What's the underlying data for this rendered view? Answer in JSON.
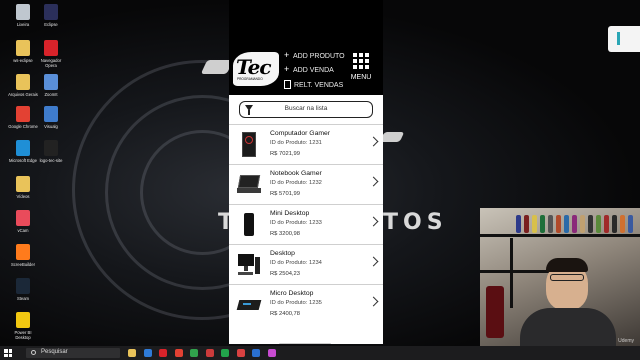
{
  "desktop": {
    "icons": [
      {
        "label": "Lixeira",
        "color": "#bfc7cf"
      },
      {
        "label": "Eclipse",
        "color": "#2b2f5a"
      },
      {
        "label": "ws-eclipse",
        "color": "#e9c35a"
      },
      {
        "label": "Navegador Opera",
        "color": "#d8232a"
      },
      {
        "label": "Arquivos Gerais",
        "color": "#e9c35a"
      },
      {
        "label": "ZoomIt",
        "color": "#5a8fd8"
      },
      {
        "label": "Google Chrome",
        "color": "#e34133"
      },
      {
        "label": "Visualg",
        "color": "#3f7ccc"
      },
      {
        "label": "Microsoft Edge",
        "color": "#1f8fd6"
      },
      {
        "label": "logo-tec-site",
        "color": "#222222"
      },
      {
        "label": "Vídeos",
        "color": "#e9c35a"
      },
      {
        "label": "vCam",
        "color": "#e94b5b"
      },
      {
        "label": "ScreeBuilder",
        "color": "#ff7b1c"
      },
      {
        "label": "Steam",
        "color": "#1b2838"
      },
      {
        "label": "Power BI Desktop",
        "color": "#f2c811"
      }
    ],
    "wallpaper_text_left": "T",
    "wallpaper_text_right": "TOS"
  },
  "app": {
    "logo": "Tec",
    "logo_sub": "PROGRAMANDO",
    "nav": {
      "add_produto": "ADD PRODUTO",
      "add_venda": "ADD VENDA",
      "relt_vendas": "RELT. VENDAS",
      "menu": "MENU"
    },
    "search_placeholder": "Buscar na lista",
    "products": [
      {
        "name": "Computador Gamer",
        "id_text": "ID do Produto: 1231",
        "price": "R$ 7021,99"
      },
      {
        "name": "Notebook Gamer",
        "id_text": "ID do Produto: 1232",
        "price": "R$ 5701,99"
      },
      {
        "name": "Mini Desktop",
        "id_text": "ID do Produto: 1233",
        "price": "R$ 3200,98"
      },
      {
        "name": "Desktop",
        "id_text": "ID do Produto: 1234",
        "price": "R$ 2504,23"
      },
      {
        "name": "Micro Desktop",
        "id_text": "ID do Produto: 1235",
        "price": "R$ 2400,78"
      }
    ]
  },
  "webcam": {
    "watermark": "Udemy"
  },
  "taskbar": {
    "search_text": "Pesquisar",
    "apps": [
      "#e9c35a",
      "#2f7bd8",
      "#d8232a",
      "#e34133",
      "#31a24c",
      "#cc3b3b",
      "#22a34b",
      "#d94141",
      "#2a6fd0",
      "#c84bd1"
    ]
  }
}
